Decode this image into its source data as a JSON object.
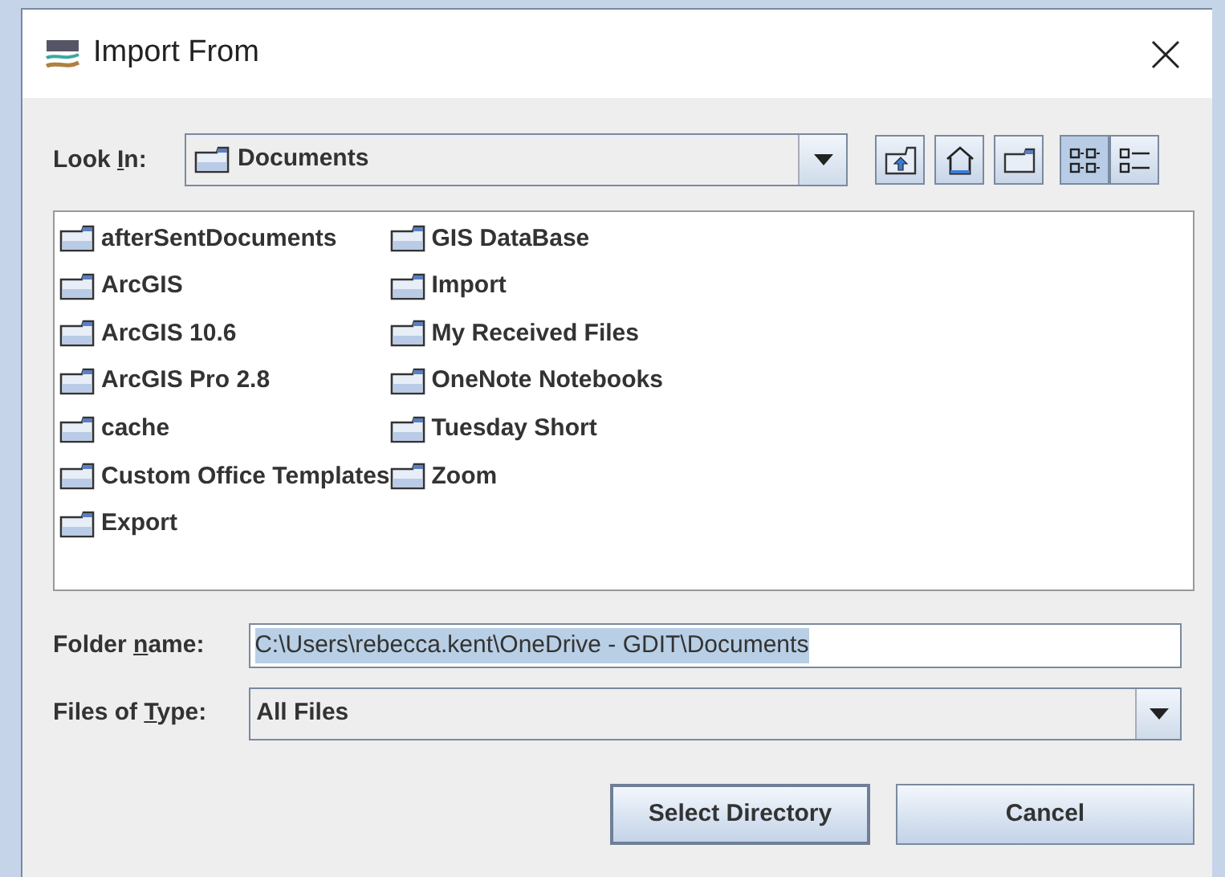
{
  "window": {
    "title": "Import From"
  },
  "look_in": {
    "label": {
      "before": "Look ",
      "mnemonic": "I",
      "after": "n:"
    },
    "value": "Documents"
  },
  "toolbar": [
    {
      "kind": "up"
    },
    {
      "kind": "home"
    },
    {
      "kind": "new-folder"
    },
    {
      "kind": "list",
      "selected": true
    },
    {
      "kind": "details",
      "selected": false
    }
  ],
  "files": [
    "afterSentDocuments",
    "ArcGIS",
    "ArcGIS 10.6",
    "ArcGIS Pro 2.8",
    "cache",
    "Custom Office Templates",
    "Export",
    "GIS DataBase",
    "Import",
    "My Received Files",
    "OneNote Notebooks",
    "Tuesday Short",
    "Zoom"
  ],
  "folder_name": {
    "label": {
      "before": "Folder ",
      "mnemonic": "n",
      "after": "ame:"
    },
    "value": "C:\\Users\\rebecca.kent\\OneDrive - GDIT\\Documents",
    "text_selected": true
  },
  "files_of_type": {
    "label": {
      "before": "Files of ",
      "mnemonic": "T",
      "after": "ype:"
    },
    "value": "All Files"
  },
  "buttons": [
    "Select Directory",
    "Cancel"
  ]
}
